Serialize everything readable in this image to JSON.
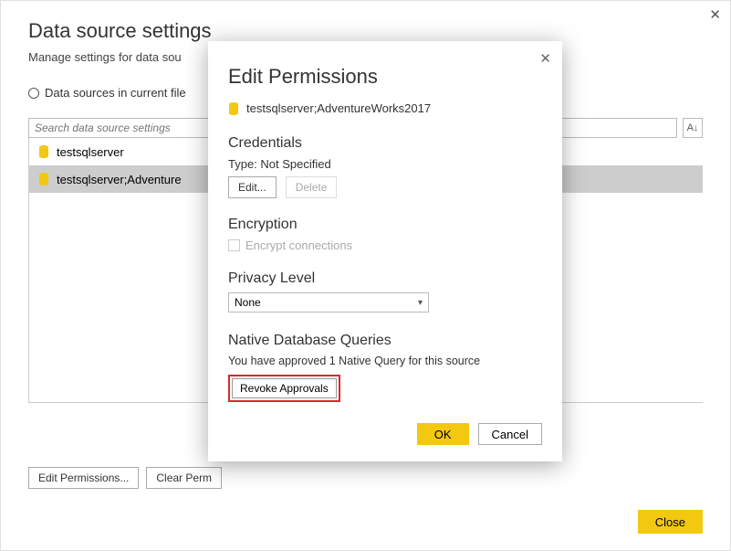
{
  "header": {
    "title": "Data source settings",
    "subtitle": "Manage settings for data sou"
  },
  "scope": {
    "current_file_label": "Data sources in current file"
  },
  "search": {
    "placeholder": "Search data source settings"
  },
  "data_sources": {
    "items": [
      {
        "label": "testsqlserver"
      },
      {
        "label": "testsqlserver;Adventure"
      }
    ]
  },
  "bottom_buttons": {
    "edit_permissions": "Edit Permissions...",
    "clear_permissions": "Clear Perm",
    "close": "Close"
  },
  "modal": {
    "title": "Edit Permissions",
    "source": "testsqlserver;AdventureWorks2017",
    "credentials": {
      "heading": "Credentials",
      "type_label": "Type: Not Specified",
      "edit": "Edit...",
      "delete": "Delete"
    },
    "encryption": {
      "heading": "Encryption",
      "checkbox_label": "Encrypt connections"
    },
    "privacy": {
      "heading": "Privacy Level",
      "value": "None"
    },
    "native": {
      "heading": "Native Database Queries",
      "message": "You have approved 1 Native Query for this source",
      "revoke": "Revoke Approvals"
    },
    "footer": {
      "ok": "OK",
      "cancel": "Cancel"
    }
  }
}
